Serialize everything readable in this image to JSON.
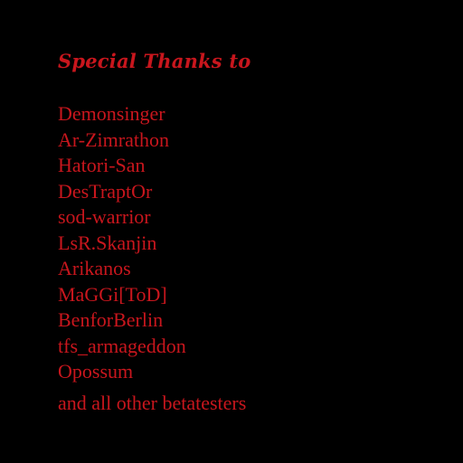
{
  "credits": {
    "heading": "Special Thanks to",
    "names": [
      "Demonsinger",
      "Ar-Zimrathon",
      "Hatori-San",
      "DesTraptOr",
      "sod-warrior",
      "LsR.Skanjin",
      "Arikanos",
      "MaGGi[ToD]",
      "BenforBerlin",
      "tfs_armageddon",
      "Opossum"
    ],
    "footer": "and all other betatesters"
  },
  "colors": {
    "background": "#000000",
    "text": "#c8161d"
  }
}
